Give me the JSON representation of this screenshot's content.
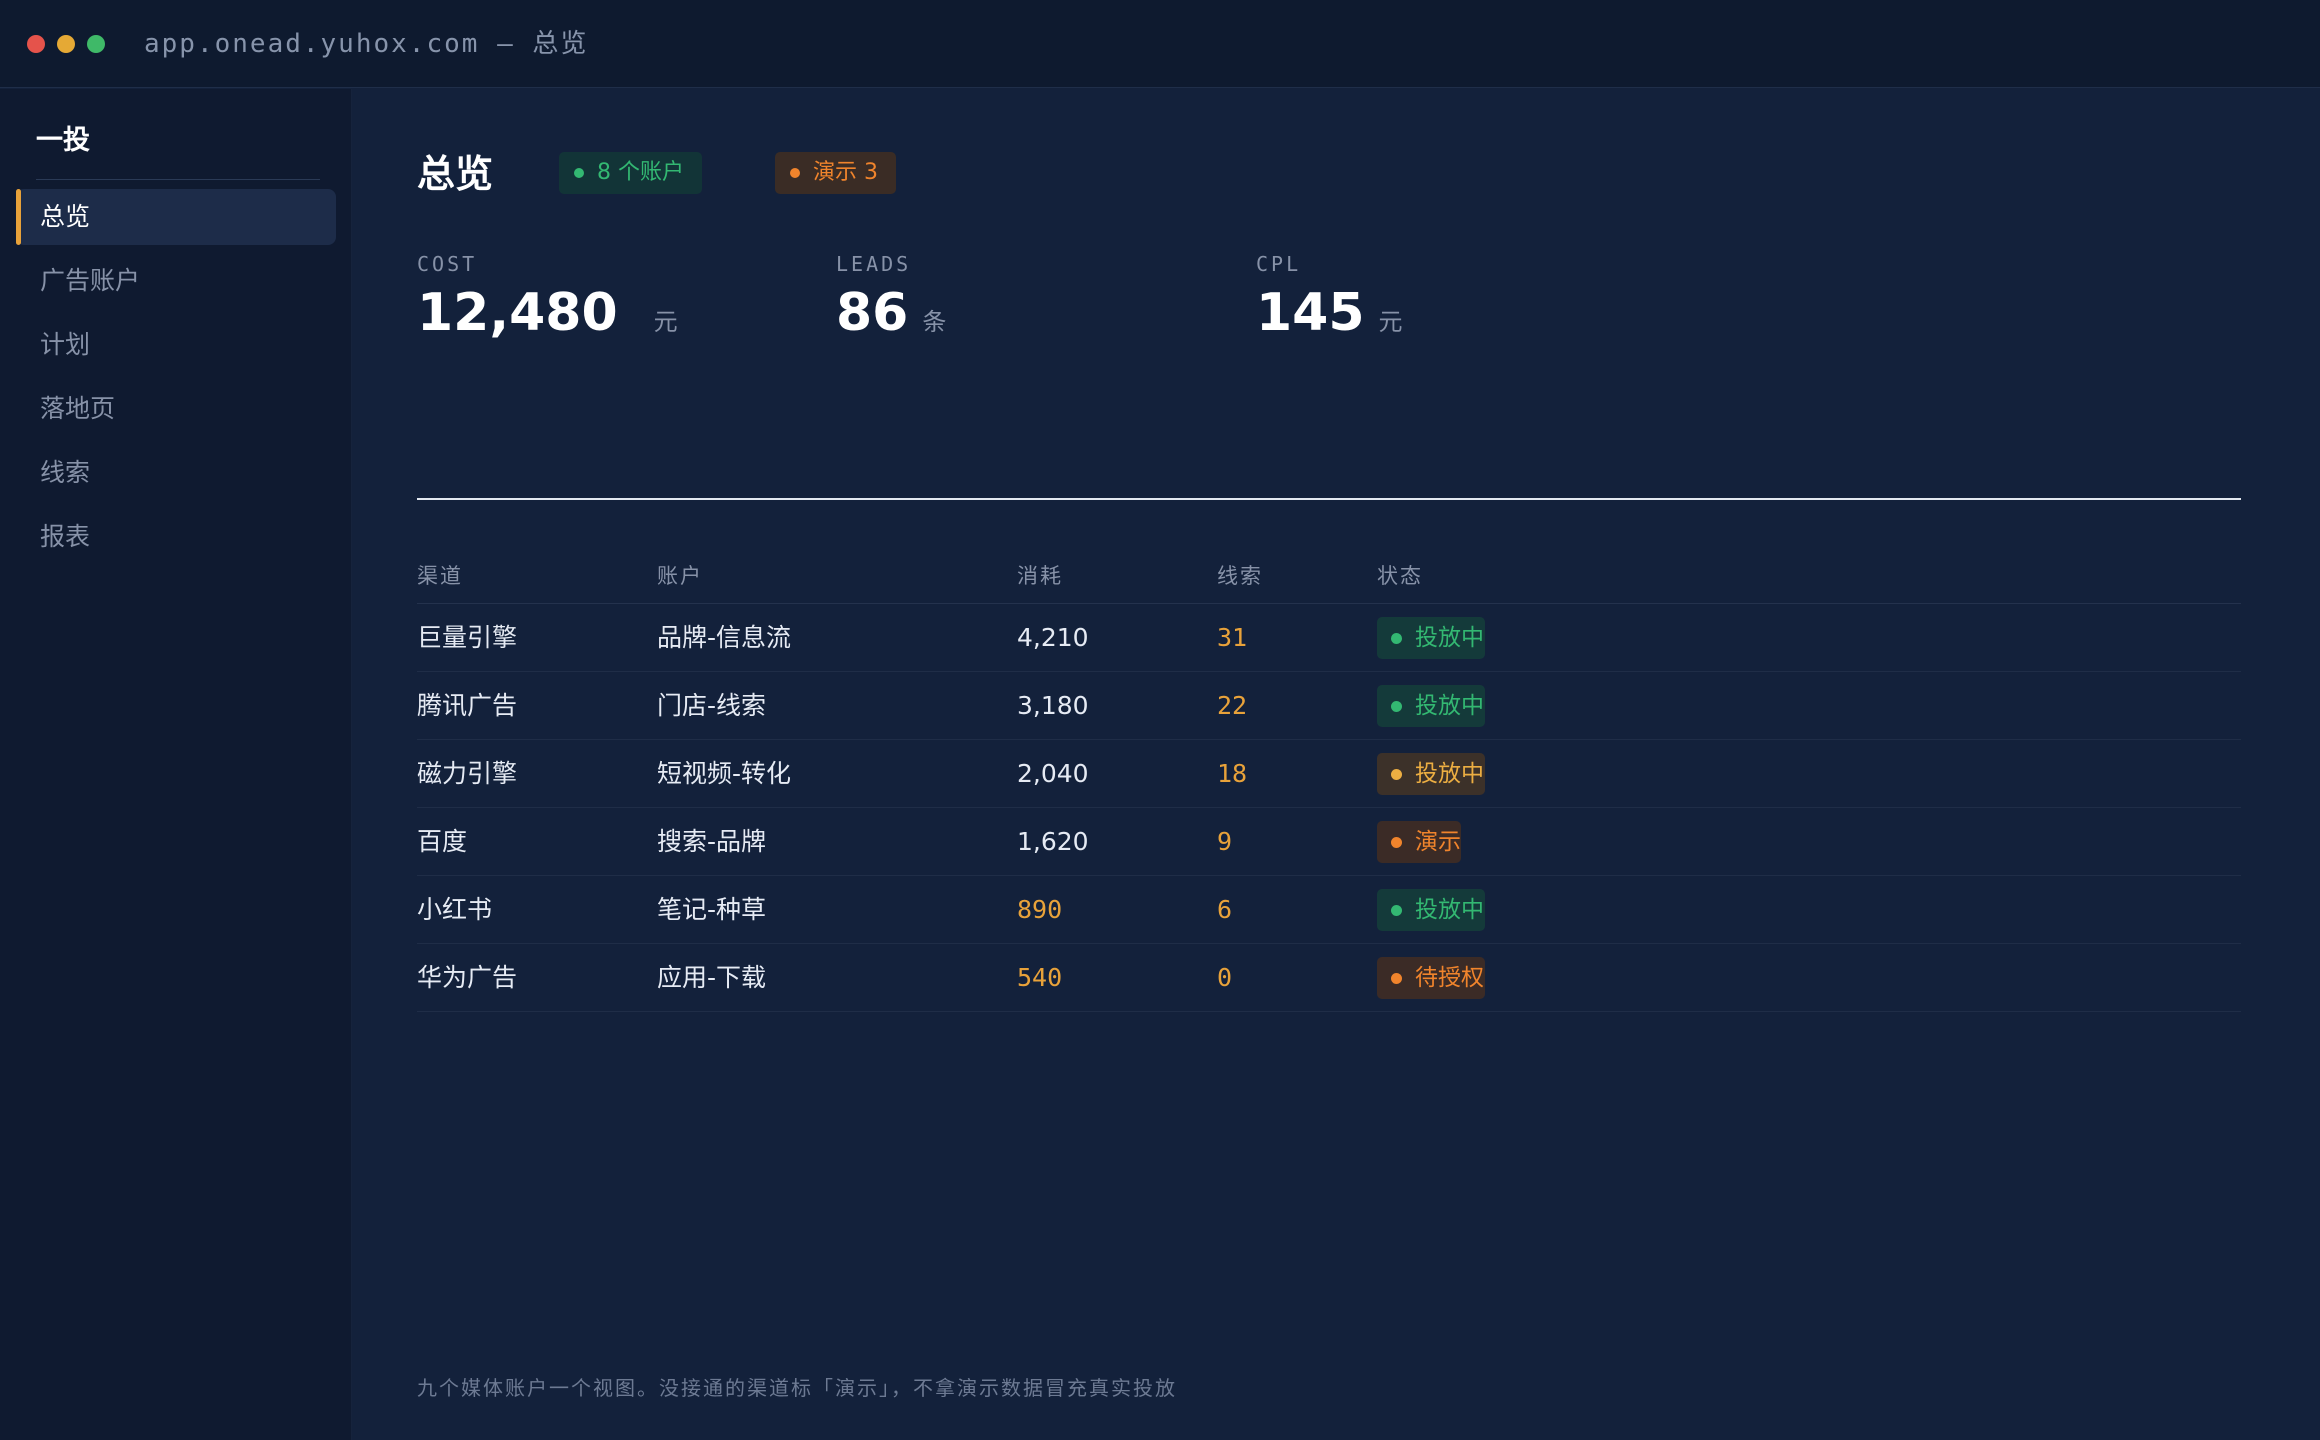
{
  "window": {
    "title": "app.onead.yuhox.com — 总览"
  },
  "sidebar": {
    "brand": "一投",
    "items": [
      {
        "label": "总览",
        "active": true
      },
      {
        "label": "广告账户",
        "active": false
      },
      {
        "label": "计划",
        "active": false
      },
      {
        "label": "落地页",
        "active": false
      },
      {
        "label": "线索",
        "active": false
      },
      {
        "label": "报表",
        "active": false
      }
    ]
  },
  "header": {
    "title": "总览",
    "accounts_chip": "8 个账户",
    "demo_chip": "演示 3"
  },
  "stats": [
    {
      "label": "COST",
      "value": "12,480",
      "unit": "元"
    },
    {
      "label": "LEADS",
      "value": "86",
      "unit": "条"
    },
    {
      "label": "CPL",
      "value": "145",
      "unit": "元"
    }
  ],
  "table": {
    "columns": [
      "渠道",
      "账户",
      "消耗",
      "线索",
      "状态"
    ],
    "rows": [
      {
        "channel": "巨量引擎",
        "account": "品牌-信息流",
        "cost": "4,210",
        "leads": "31",
        "status": "投放中"
      },
      {
        "channel": "腾讯广告",
        "account": "门店-线索",
        "cost": "3,180",
        "leads": "22",
        "status": "投放中"
      },
      {
        "channel": "磁力引擎",
        "account": "短视频-转化",
        "cost": "2,040",
        "leads": "18",
        "status": "投放中"
      },
      {
        "channel": "百度",
        "account": "搜索-品牌",
        "cost": "1,620",
        "leads": "9",
        "status": "演示"
      },
      {
        "channel": "小红书",
        "account": "笔记-种草",
        "cost": "890",
        "leads": "6",
        "status": "投放中"
      },
      {
        "channel": "华为广告",
        "account": "应用-下载",
        "cost": "540",
        "leads": "0",
        "status": "待授权"
      }
    ]
  },
  "footnote": "九个媒体账户一个视图。没接通的渠道标「演示」，不拿演示数据冒充真实投放",
  "colors": {
    "accent": "#e8a23a",
    "status_live": "#33b872",
    "status_demo": "#f0842c",
    "background": "#13213b"
  }
}
